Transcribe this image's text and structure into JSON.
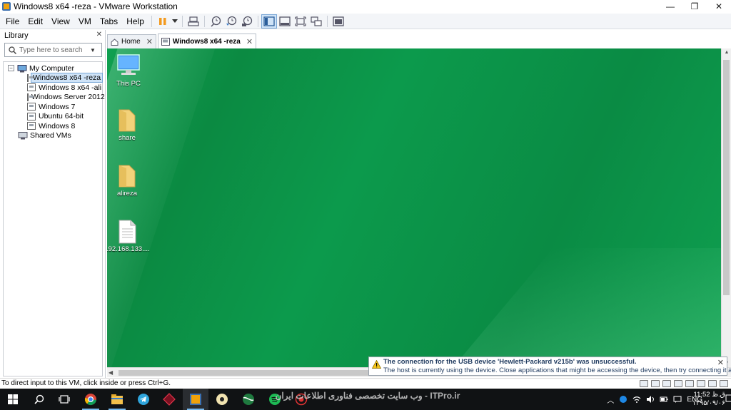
{
  "window": {
    "title": "Windows8 x64 -reza - VMware Workstation",
    "minimize": "—",
    "restore": "❐",
    "close": "✕"
  },
  "menu": [
    "File",
    "Edit",
    "View",
    "VM",
    "Tabs",
    "Help"
  ],
  "library": {
    "header": "Library",
    "close": "✕",
    "search_placeholder": "Type here to search",
    "tree": {
      "root_label": "My Computer",
      "vms": [
        "Windows8 x64 -reza",
        "Windows 8 x64 -ali",
        "Windows Server 2012",
        "Windows 7",
        "Ubuntu 64-bit",
        "Windows 8"
      ],
      "selected_index": 0,
      "shared_label": "Shared VMs"
    }
  },
  "tabs": [
    {
      "label": "Home",
      "active": false
    },
    {
      "label": "Windows8 x64 -reza",
      "active": true
    }
  ],
  "desktop": {
    "icons": [
      {
        "label": "This PC",
        "kind": "pc-icon"
      },
      {
        "label": "share",
        "kind": "folder-icon"
      },
      {
        "label": "alireza",
        "kind": "folder-icon"
      },
      {
        "label": "192.168.133....",
        "kind": "file-icon"
      }
    ]
  },
  "notification": {
    "title": "The connection for the USB device 'Hewlett-Packard v215b' was unsuccessful.",
    "message": "The host is currently using the device. Close applications that might be accessing the device, then try connecting it again.",
    "close": "✕"
  },
  "statusbar": {
    "text": "To direct input to this VM, click inside or press Ctrl+G."
  },
  "taskbar": {
    "watermark": "وب سایت تخصصی فناوری اطلاعات ایران - ITPro.ir",
    "language": "ENG",
    "time": "11:52 ق.ظ",
    "date": "۱۳۹۵/۰۹/۰۶"
  },
  "colors": {
    "desktop_green": "#0b8a42",
    "selection": "#cfe3f7",
    "taskbar": "#101214"
  }
}
